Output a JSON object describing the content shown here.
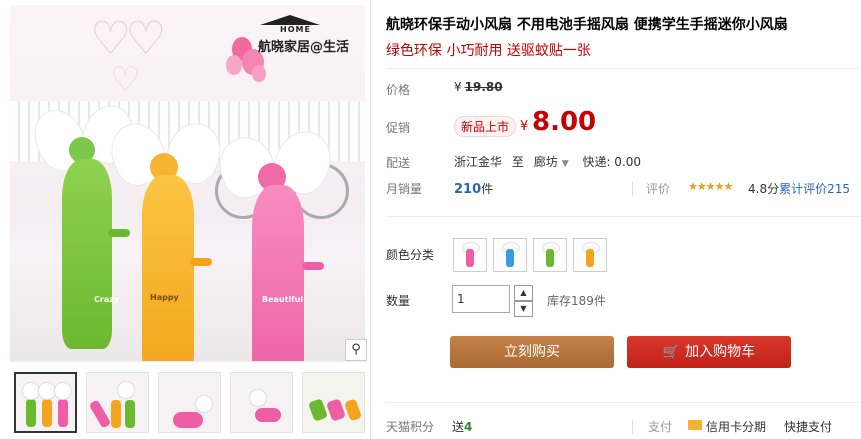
{
  "gallery": {
    "watermark_home": "HOME",
    "watermark_text": "航晓家居@生活",
    "fan_labels": [
      "Crazy",
      "Happy",
      "Beautiful"
    ],
    "zoom_icon": "magnifier-icon",
    "thumbnails": 5
  },
  "product": {
    "title": "航晓环保手动小风扇 不用电池手摇风扇 便携学生手摇迷你小风扇",
    "subtitle": "绿色环保 小巧耐用 送驱蚊贴一张"
  },
  "price": {
    "label": "价格",
    "currency": "¥",
    "original": "19.80",
    "promo_label": "促销",
    "promo_badge": "新品上市",
    "promo_price": "8.00"
  },
  "shipping": {
    "label": "配送",
    "from": "浙江金华",
    "to_word": "至",
    "to": "廊坊",
    "fee": "快递: 0.00"
  },
  "sales": {
    "label": "月销量",
    "count": "210",
    "unit": "件",
    "rating_label": "评价",
    "stars": "★★★★★",
    "rating_text": "4.8分",
    "count_text": "累计评价215"
  },
  "options": {
    "color_label": "颜色分类",
    "colors": [
      "#ee5ea6",
      "#3a9be0",
      "#6bb92f",
      "#f3a41d"
    ],
    "qty_label": "数量",
    "qty_value": "1",
    "stepper_up": "▲",
    "stepper_down": "▼",
    "stock": "库存189件"
  },
  "actions": {
    "buy_now": "立刻购买",
    "add_cart": "加入购物车",
    "cart_icon": "🛒"
  },
  "footer": {
    "points_label": "天猫积分",
    "points_prefix": "送",
    "points_value": "4",
    "pay_label": "支付",
    "card_label": "信用卡分期",
    "quickpay": "快捷支付"
  }
}
